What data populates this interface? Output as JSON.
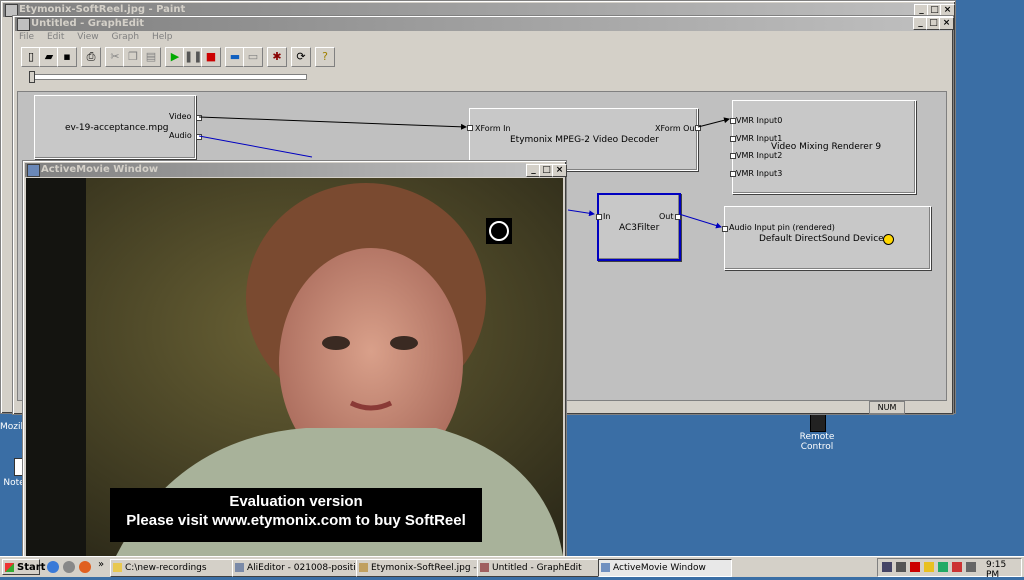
{
  "paint_window": {
    "title": "Etymonix-SoftReel.jpg - Paint"
  },
  "graphedit": {
    "title": "Untitled - GraphEdit",
    "menu": [
      "File",
      "Edit",
      "View",
      "Graph",
      "Help"
    ],
    "status_num": "NUM",
    "filters": {
      "source": {
        "name": "ev-19-acceptance.mpg",
        "pins": [
          "Video",
          "Audio"
        ]
      },
      "decoder": {
        "name": "Etymonix MPEG-2 Video Decoder",
        "in_pin": "XForm In",
        "out_pin": "XForm Out"
      },
      "vmr": {
        "name": "Video Mixing Renderer 9",
        "pins": [
          "VMR Input0",
          "VMR Input1",
          "VMR Input2",
          "VMR Input3"
        ]
      },
      "ac3": {
        "name": "AC3Filter",
        "in_pin": "In",
        "out_pin": "Out"
      },
      "dsound": {
        "name": "Default DirectSound Device",
        "pin": "Audio Input pin (rendered)"
      }
    }
  },
  "activemovie": {
    "title": "ActiveMovie Window",
    "overlay_line1": "Evaluation version",
    "overlay_line2": "Please visit www.etymonix.com to buy SoftReel"
  },
  "desktop": {
    "icons": [
      {
        "label": "Remote Control"
      }
    ],
    "partial_labels": [
      "Mozill",
      "Note"
    ]
  },
  "taskbar": {
    "start_label": "Start",
    "tasks": [
      {
        "label": "C:\\new-recordings"
      },
      {
        "label": "AliEditor - 021008-positio..."
      },
      {
        "label": "Etymonix-SoftReel.jpg - ..."
      },
      {
        "label": "Untitled - GraphEdit"
      },
      {
        "label": "ActiveMovie Window"
      }
    ],
    "clock": "9:15 PM"
  }
}
